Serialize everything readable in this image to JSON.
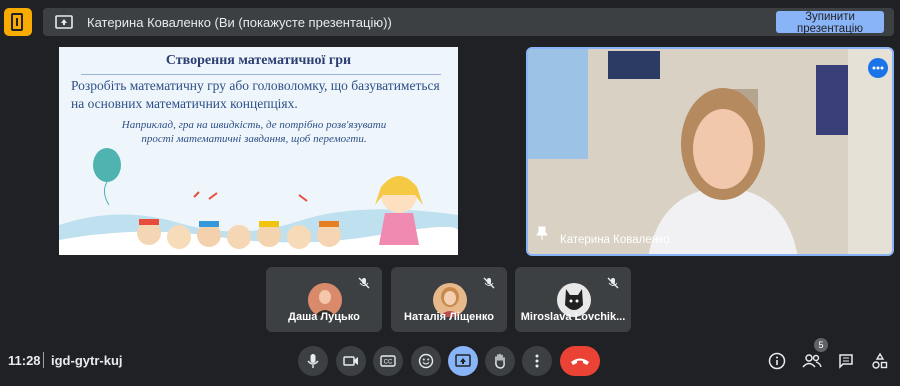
{
  "header": {
    "presenter_text": "Катерина Коваленко (Ви (покажусте презентацію))",
    "stop_button_label": "Зупинити презентацію"
  },
  "slide": {
    "title": "Створення математичної гри",
    "body": "Розробіть математичну гру або головоломку, що базуватиметься на основних математичних концепціях.",
    "example": "Наприклад, гра на швидкість, де потрібно розв'язувати прості математичні завдання, щоб перемогти."
  },
  "self_tile": {
    "name": "Катерина Коваленко",
    "border_color": "#8ab4f8"
  },
  "participants": [
    {
      "name": "Даша Луцько"
    },
    {
      "name": "Наталія Ліщенко"
    },
    {
      "name": "Miroslava Lovchik..."
    }
  ],
  "footer": {
    "time": "11:28",
    "meeting_code": "igd-gytr-kuj",
    "participant_count": "5"
  },
  "controls": [
    "mic-icon",
    "camera-icon",
    "captions-icon",
    "emoji-icon",
    "present-icon",
    "raise-hand-icon",
    "more-vert-icon",
    "hangup-icon"
  ],
  "right_controls": [
    "info-icon",
    "people-icon",
    "chat-icon",
    "activities-icon"
  ],
  "colors": {
    "background": "#202124",
    "accent": "#8ab4f8",
    "hangup": "#ea4335",
    "logo": "#f9ab00"
  }
}
